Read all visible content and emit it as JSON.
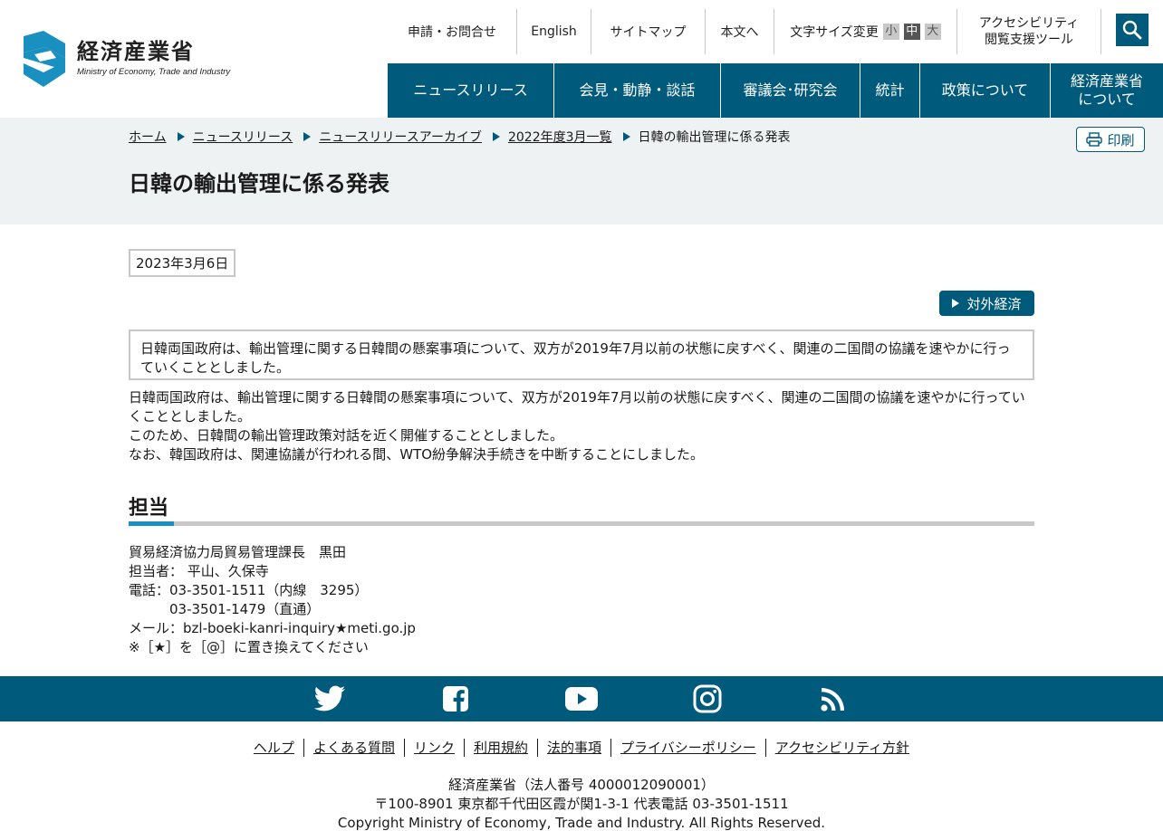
{
  "header": {
    "logo_text": "経済産業省",
    "logo_subtext": "Ministry of Economy, Trade and Industry",
    "utility_links": [
      "申請・お問合せ",
      "English",
      "サイトマップ",
      "本文へ"
    ],
    "font_size": {
      "label": "文字サイズ変更",
      "options": [
        "小",
        "中",
        "大"
      ],
      "selected": "中"
    },
    "accessibility": [
      "アクセシビリティ",
      "閲覧支援ツール"
    ],
    "search_icon": "search-icon"
  },
  "global_nav": [
    {
      "label": "ニュースリリース"
    },
    {
      "label": "会見・動静・談話"
    },
    {
      "label": "審議会･研究会"
    },
    {
      "label": "統計"
    },
    {
      "label": "政策について"
    },
    {
      "label": "経済産業省",
      "label2": "について"
    }
  ],
  "breadcrumb": [
    "ホーム",
    "ニュースリリース",
    "ニュースリリースアーカイブ",
    "2022年度3月一覧",
    "日韓の輸出管理に係る発表"
  ],
  "print_label": "印刷",
  "page_title": "日韓の輸出管理に係る発表",
  "date": "2023年3月6日",
  "category_tag": "対外経済",
  "summary": "日韓両国政府は、輸出管理に関する日韓間の懸案事項について、双方が2019年7月以前の状態に戻すべく、関連の二国間の協議を速やかに行っていくこととしました。",
  "body": [
    "日韓両国政府は、輸出管理に関する日韓間の懸案事項について、双方が2019年7月以前の状態に戻すべく、関連の二国間の協議を速やかに行っていくこととしました。",
    "このため、日韓間の輸出管理政策対話を近く開催することとしました。",
    "なお、韓国政府は、関連協議が行われる間、WTO紛争解決手続きを中断することにしました。"
  ],
  "contact": {
    "heading": "担当",
    "lines": [
      "貿易経済協力局貿易管理課長　黒田",
      "担当者： 平山、久保寺",
      "電話：03-3501-1511（内線　3295）",
      "　　　03-3501-1479（直通）",
      "メール：bzl-boeki-kanri-inquiry★meti.go.jp",
      "※［★］を［@］に置き換えてください"
    ]
  },
  "social_icons": [
    "twitter-icon",
    "facebook-icon",
    "youtube-icon",
    "instagram-icon",
    "rss-icon"
  ],
  "footer_links": [
    "ヘルプ",
    "よくある質問",
    "リンク",
    "利用規約",
    "法的事項",
    "プライバシーポリシー",
    "アクセシビリティ方針"
  ],
  "footer_info": [
    "経済産業省（法人番号 4000012090001）",
    "〒100-8901 東京都千代田区霞が関1-3-1 代表電話 03-3501-1511",
    "Copyright Ministry of Economy, Trade and Industry. All Rights Reserved."
  ],
  "colors": {
    "primary": "#005a7c",
    "accent": "#1a90c0",
    "band": "#eef2f3",
    "border": "#c8c8c8"
  }
}
